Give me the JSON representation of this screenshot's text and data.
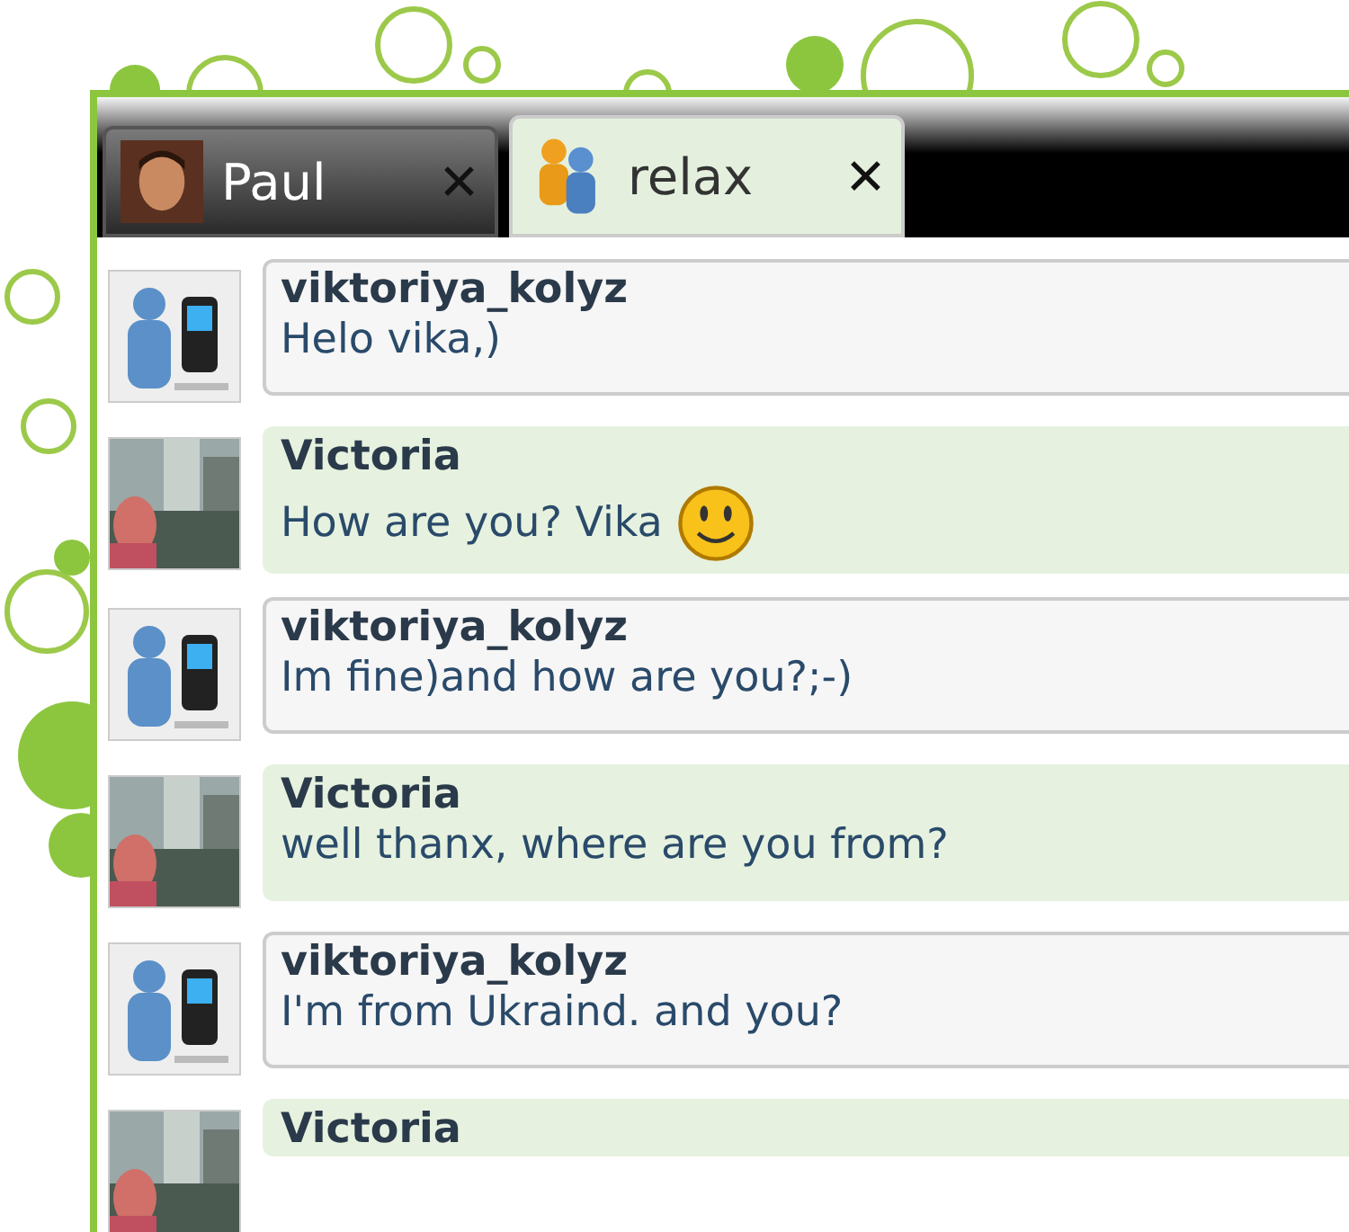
{
  "tabs": [
    {
      "label": "Paul",
      "selected": false,
      "close": "✕"
    },
    {
      "label": "relax",
      "kind": "group",
      "selected": true,
      "close": "✕"
    }
  ],
  "messages": [
    {
      "kind": "mobile",
      "name": "viktoriya_kolyz",
      "text": "Helo vika,)",
      "smiley": false
    },
    {
      "name": "Victoria",
      "text": "How are you? Vika",
      "smiley": true
    },
    {
      "kind": "mobile",
      "name": "viktoriya_kolyz",
      "text": "Im fine)and how are you?;-)",
      "smiley": false
    },
    {
      "name": "Victoria",
      "text": "well thanx, where are you from?",
      "smiley": false
    },
    {
      "kind": "mobile",
      "name": "viktoriya_kolyz",
      "text": "I'm from Ukraind. and you?",
      "smiley": false
    },
    {
      "name": "Victoria"
    }
  ]
}
